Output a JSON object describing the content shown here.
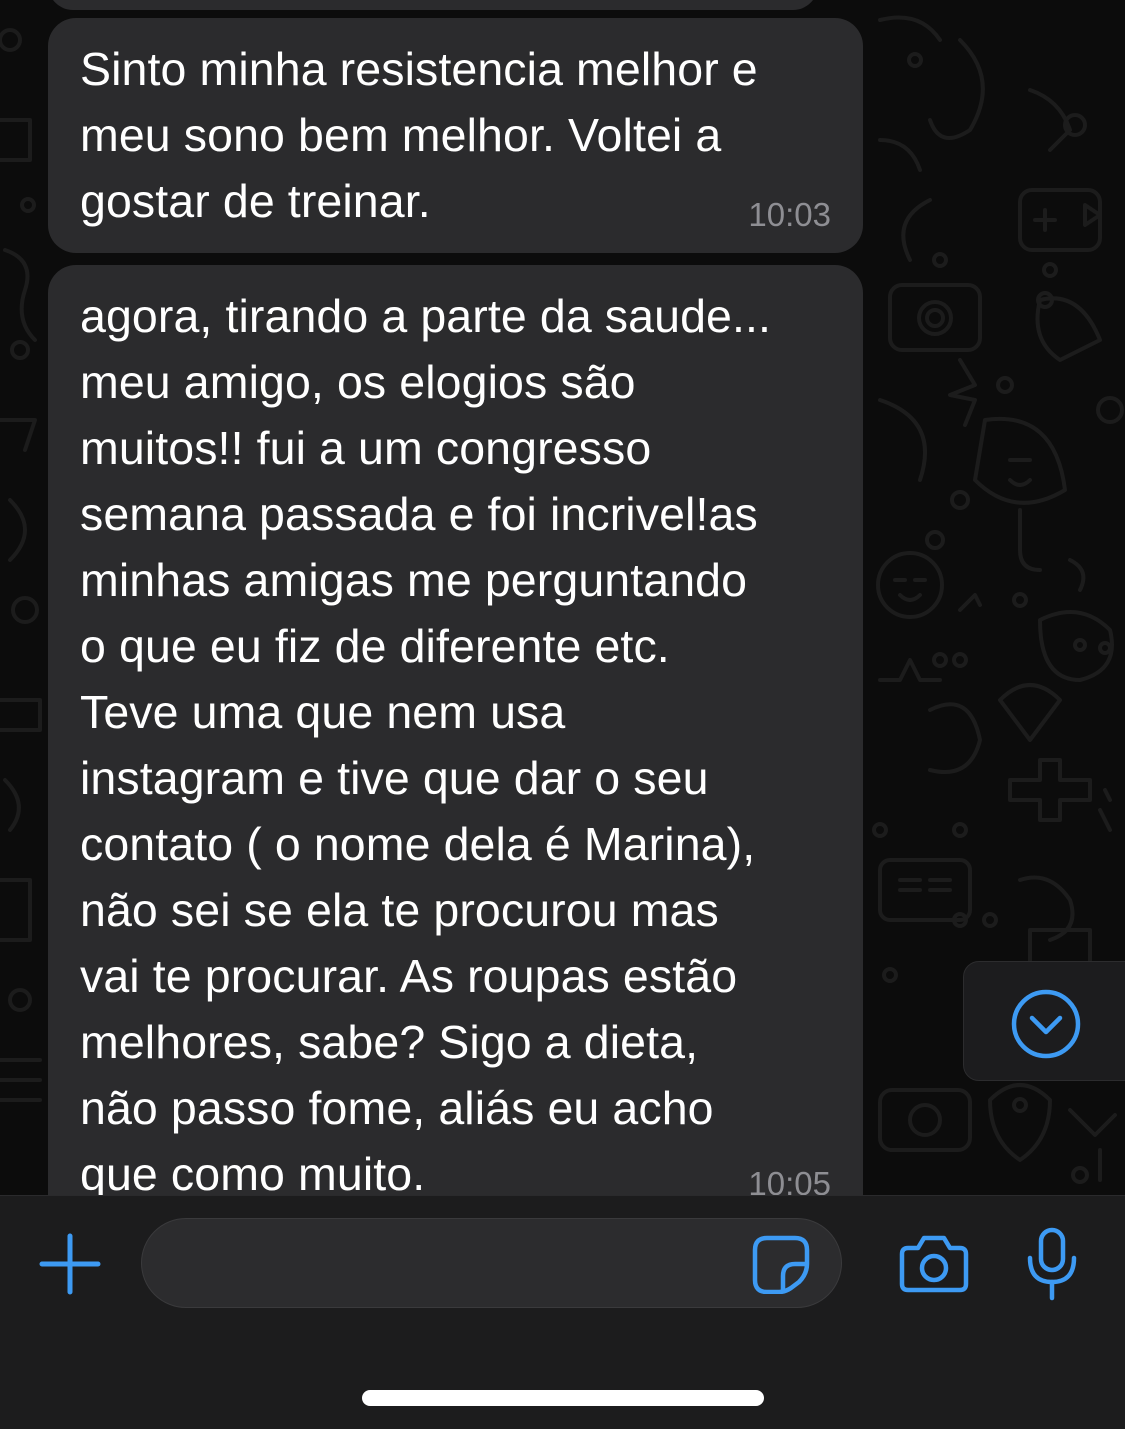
{
  "messages": [
    {
      "text": "Sinto minha resistencia melhor e\nmeu sono bem melhor. Voltei a\ngostar de treinar.",
      "time": "10:03"
    },
    {
      "text": "agora, tirando a parte da saude...\nmeu amigo, os elogios são\nmuitos!! fui a um congresso\nsemana passada e foi incrivel!as\nminhas amigas me perguntando\no que eu fiz de diferente etc.\nTeve uma que nem usa\ninstagram e tive que dar o seu\ncontato ( o nome dela é Marina),\nnão sei se ela te procurou mas\nvai te procurar. As roupas estão\nmelhores, sabe? Sigo a dieta,\nnão passo fome, aliás eu acho\nque como muito.",
      "time": "10:05"
    }
  ],
  "composer": {
    "input_value": "",
    "icons": [
      "plus-icon",
      "sticker-icon",
      "camera-icon",
      "microphone-icon"
    ]
  },
  "scroll_button": {
    "icon": "chevron-down-circle-icon"
  },
  "colors": {
    "accent": "#3d9af3",
    "bubble": "#2b2b2d",
    "timestamp": "#8e8e93",
    "background": "#0c0c0c"
  }
}
